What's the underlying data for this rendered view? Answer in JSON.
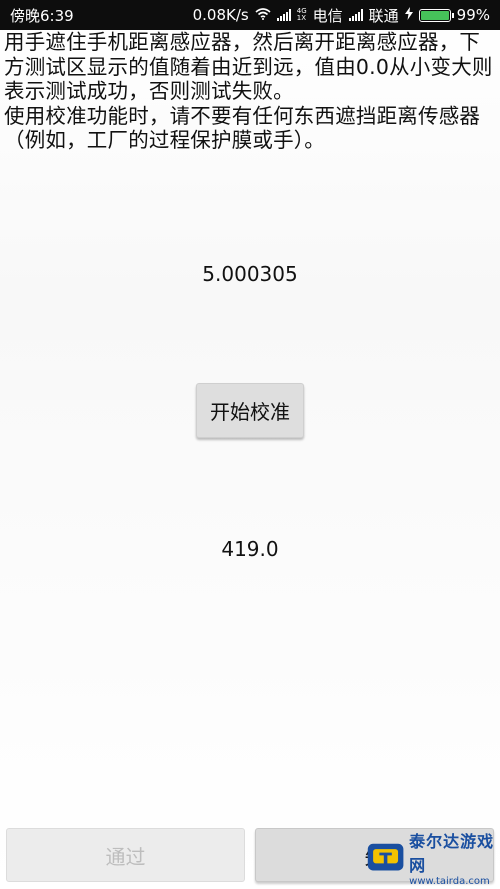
{
  "statusbar": {
    "time": "傍晚6:39",
    "speed": "0.08K/s",
    "net_top": "4G",
    "net_bottom": "1X",
    "carrier1": "电信",
    "carrier2": "联通",
    "battery": "99%",
    "battery_level": 0.99
  },
  "instructions": {
    "line1": "用手遮住手机距离感应器，然后离开距离感应器，下方测试区显示的值随着由近到远，值由0.0从小变大则表示测试成功，否则测试失败。",
    "line2": "使用校准功能时，请不要有任何东西遮挡距离传感器（例如，工厂的过程保护膜或手）。"
  },
  "sensor_value": "5.000305",
  "calibrate_button": "开始校准",
  "calibration_value": "419.0",
  "buttons": {
    "pass": "通过",
    "fail": "失"
  },
  "watermark": {
    "name": "泰尔达游戏网",
    "url": "www.tairda.com"
  }
}
